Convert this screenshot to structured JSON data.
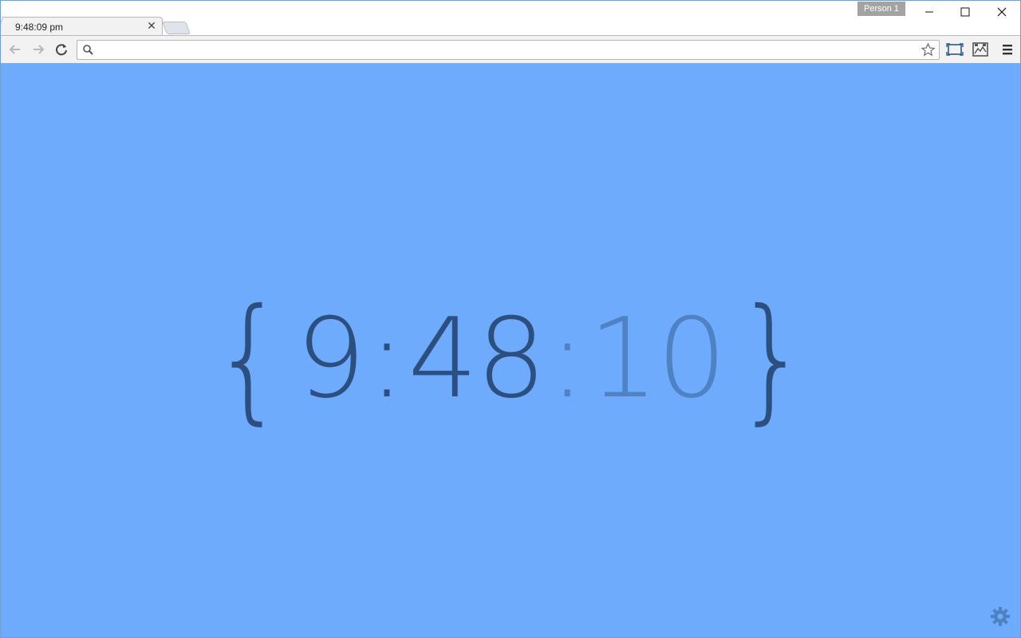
{
  "tab": {
    "title": "9:48:09 pm",
    "close_symbol": "✕"
  },
  "profile": {
    "name": "Person 1"
  },
  "omnibox": {
    "value": "",
    "placeholder": ""
  },
  "clock": {
    "open_brace": "{",
    "hour": "9",
    "sep1": ":",
    "minute": "48",
    "sep2": ":",
    "second": "10",
    "close_brace": "}"
  },
  "icons": {
    "back": "arrow-left-icon",
    "forward": "arrow-right-icon",
    "reload": "reload-icon",
    "search": "search-icon",
    "star": "star-icon",
    "cast": "cast-icon",
    "extension": "extension-icon",
    "menu": "hamburger-menu-icon",
    "settings": "gear-icon"
  },
  "colors": {
    "background": "#6eabfd",
    "clock_primary": "#2c4f7f",
    "clock_faded": "#4f82c3"
  }
}
